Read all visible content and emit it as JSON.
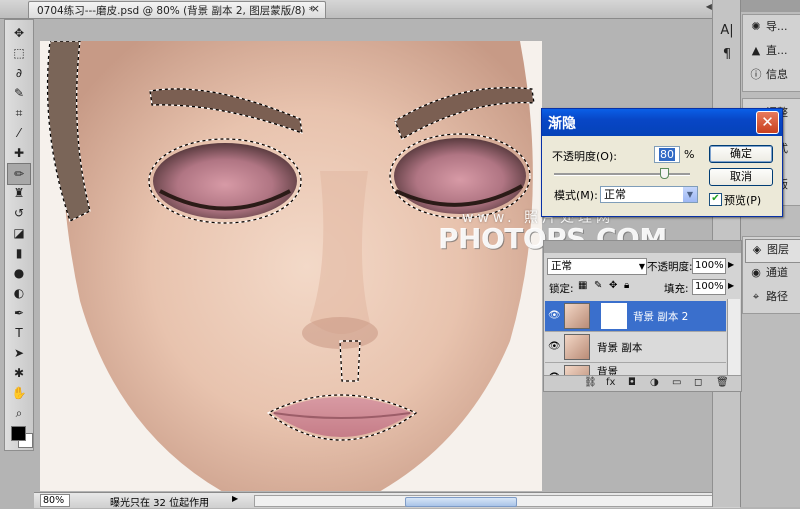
{
  "document": {
    "tab_title": "0704练习---磨皮.psd @ 80% (背景 副本 2, 图层蒙版/8) *",
    "close_glyph": "×",
    "zoom": "80%",
    "status": "曝光只在 32 位起作用"
  },
  "toolbar": {
    "tools": [
      "move-icon",
      "marquee-icon",
      "lasso-icon",
      "quick-select-icon",
      "crop-icon",
      "eyedropper-icon",
      "healing-icon",
      "brush-icon",
      "stamp-icon",
      "history-brush-icon",
      "eraser-icon",
      "gradient-icon",
      "blur-icon",
      "dodge-icon",
      "pen-icon",
      "type-icon",
      "path-select-icon",
      "shape-icon",
      "hand-icon",
      "zoom-icon"
    ],
    "foreground_color": "#000000",
    "background_color": "#ffffff"
  },
  "dock": {
    "top_items": [
      {
        "icon": "navigator-icon",
        "label": "导..."
      },
      {
        "icon": "histogram-icon",
        "label": "直..."
      },
      {
        "icon": "info-icon",
        "label": "信息"
      }
    ],
    "middle_items": [
      {
        "icon": "adjustments-icon",
        "label": "调整"
      },
      {
        "icon": "styles-icon",
        "label": "样式"
      },
      {
        "icon": "masks-icon",
        "label": "蒙版"
      }
    ],
    "bottom_items": [
      {
        "icon": "layers-icon",
        "label": "图层"
      },
      {
        "icon": "channels-icon",
        "label": "通道"
      },
      {
        "icon": "paths-icon",
        "label": "路径"
      }
    ]
  },
  "fade_dialog": {
    "title": "渐隐",
    "opacity_label": "不透明度(O):",
    "opacity_value": "80",
    "opacity_unit": "%",
    "opacity_fraction": 0.8,
    "mode_label": "模式(M):",
    "mode_value": "正常",
    "ok_label": "确定",
    "cancel_label": "取消",
    "preview_label": "预览(P)",
    "preview_checked": true
  },
  "layers_panel": {
    "blend_mode": "正常",
    "opacity_label": "不透明度:",
    "opacity_value": "100%",
    "lock_label": "锁定:",
    "fill_label": "填充:",
    "fill_value": "100%",
    "layers": [
      {
        "name": "背景 副本 2",
        "active": true,
        "has_mask": true
      },
      {
        "name": "背景 副本",
        "active": false,
        "has_mask": false
      },
      {
        "name": "背景",
        "active": false,
        "has_mask": false
      }
    ]
  },
  "watermark": {
    "line1": "www. 照片处理网",
    "line2": "PHOTOPS.COM"
  }
}
